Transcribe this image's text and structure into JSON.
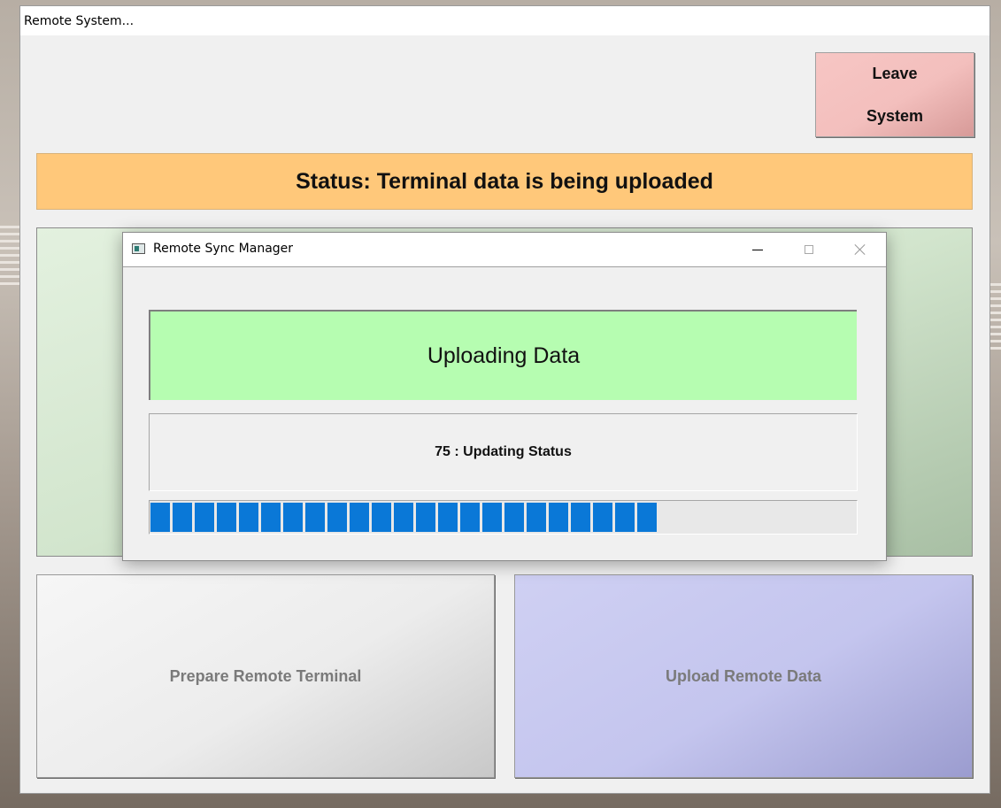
{
  "main_window": {
    "title": "Remote System...",
    "leave_button": {
      "line1": "Leave",
      "line2": "System",
      "color": "#f4c2c0"
    },
    "status_banner": {
      "text": "Status: Terminal data is being uploaded",
      "color": "#ffc87a"
    },
    "prepare_button": {
      "label": "Prepare Remote Terminal"
    },
    "upload_button": {
      "label": "Upload Remote Data"
    }
  },
  "dialog": {
    "title": "Remote Sync Manager",
    "icon": "app-window-icon",
    "controls": [
      "minimize-icon",
      "maximize-icon",
      "close-icon"
    ],
    "header_text": "Uploading Data",
    "header_color": "#b6fdb1",
    "step_text": "75 : Updating Status",
    "progress": {
      "percent": 72,
      "color": "#0a78d7"
    }
  }
}
